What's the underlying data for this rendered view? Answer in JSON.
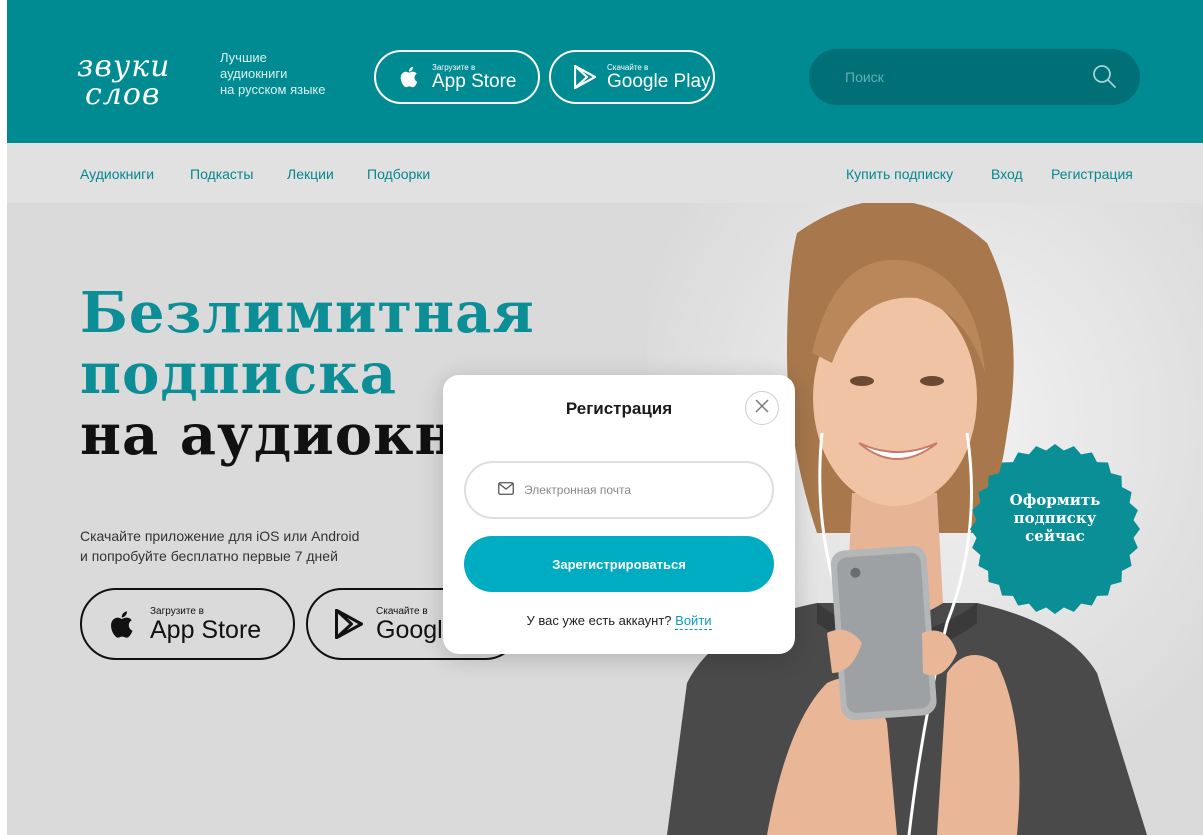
{
  "header": {
    "logo": {
      "line1": "звуки",
      "line2": "слов"
    },
    "tagline": [
      "Лучшие",
      "аудиокниги",
      "на русском языке"
    ],
    "app_store": {
      "small": "Загрузите в",
      "big": "App Store"
    },
    "google_play": {
      "small": "Скачайте в",
      "big": "Google Play"
    },
    "search": {
      "placeholder": "Поиск",
      "value": ""
    }
  },
  "nav": {
    "left": [
      "Аудиокниги",
      "Подкасты",
      "Лекции",
      "Подборки"
    ],
    "right": [
      "Купить подписку",
      "Вход",
      "Регистрация"
    ]
  },
  "hero": {
    "title_line1": "Безлимитная",
    "title_line2": "подписка",
    "title_line3": "на аудиокн",
    "subtitle": [
      "Скачайте приложение для iOS или Android",
      "и попробуйте бесплатно первые 7 дней"
    ],
    "app_store": {
      "small": "Загрузите в",
      "big": "App Store"
    },
    "google_play": {
      "small": "Скачайте в",
      "big": "Googl"
    },
    "badge": [
      "Оформить",
      "подписку",
      "сейчас"
    ]
  },
  "modal": {
    "title": "Регистрация",
    "email": {
      "placeholder": "Электронная почта",
      "value": ""
    },
    "register_label": "Зарегистрироваться",
    "have_account": "У вас уже есть аккаунт?",
    "login_link": "Войти"
  },
  "colors": {
    "brand_teal": "#008b92",
    "search_bg": "#016f76",
    "nav_bg": "#e1e1e1",
    "nav_link": "#058890",
    "hero_bg": "#dadada",
    "register_btn": "#00acc1",
    "badge": "#0a8f96"
  }
}
